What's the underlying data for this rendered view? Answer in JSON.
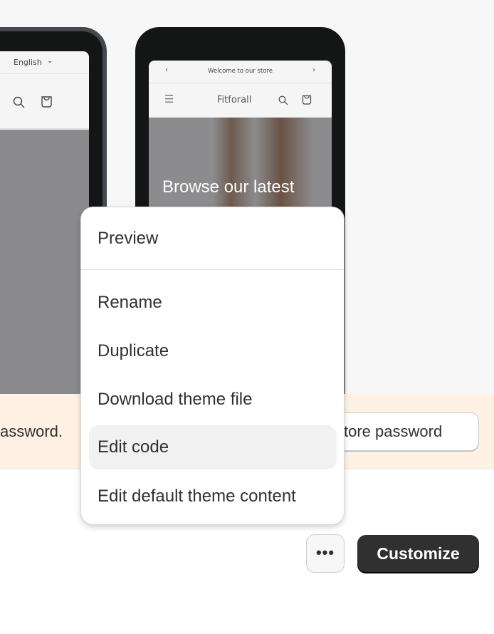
{
  "preview_left": {
    "language": "English"
  },
  "preview_right": {
    "announcement": "Welcome to our store",
    "store_name": "Fitforall",
    "hero_text": "Browse our latest"
  },
  "banner": {
    "text": "assword.",
    "button_label": "tore password"
  },
  "menu": {
    "items": [
      "Preview",
      "Rename",
      "Duplicate",
      "Download theme file",
      "Edit code",
      "Edit default theme content"
    ]
  },
  "actions": {
    "more_label": "•••",
    "customize_label": "Customize"
  },
  "colors": {
    "banner": "#fff1e3",
    "primary_button": "#303030",
    "highlight": "#f1f1f1"
  }
}
